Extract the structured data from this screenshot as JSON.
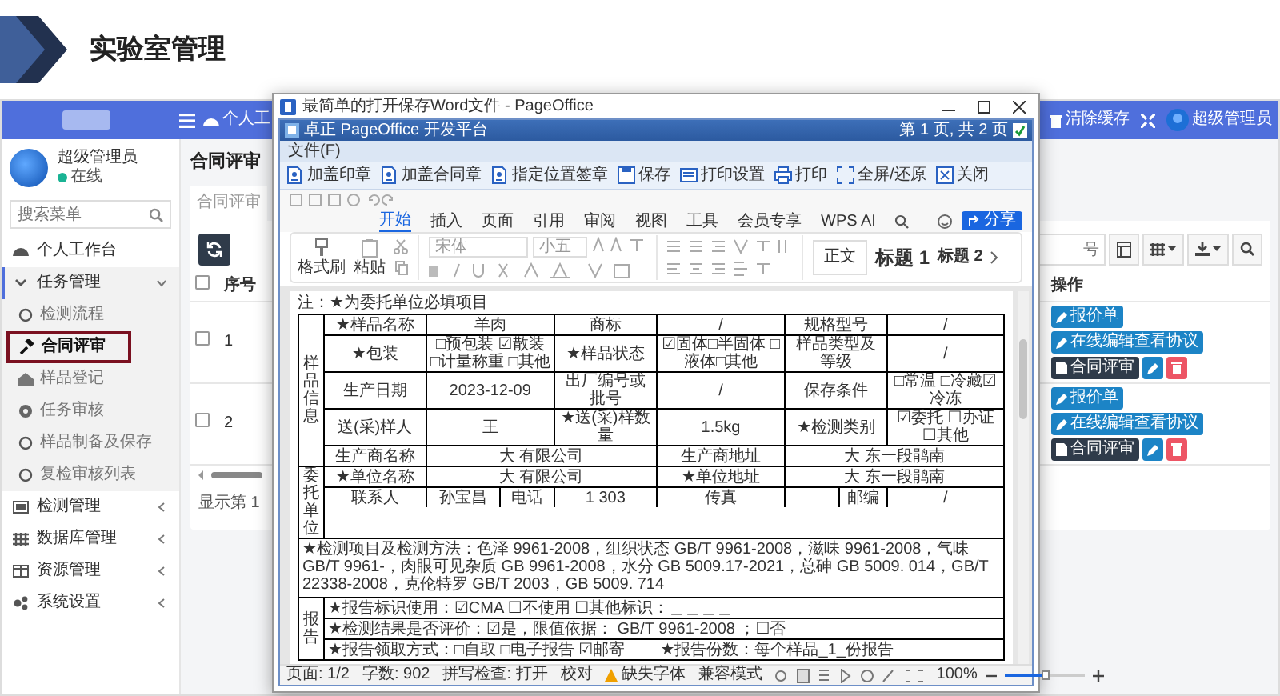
{
  "slide": {
    "title": "实验室管理"
  },
  "navbar": {
    "home_link": "个人工",
    "clear_cache": "清除缓存",
    "user": "超级管理员"
  },
  "sidebar": {
    "user": {
      "name": "超级管理员",
      "status": "在线",
      "online": true
    },
    "search": {
      "placeholder": "搜索菜单"
    },
    "items": [
      {
        "label": "个人工作台",
        "kind": "link"
      },
      {
        "label": "任务管理",
        "kind": "group",
        "expanded": true,
        "children": [
          {
            "label": "检测流程",
            "selected": false
          },
          {
            "label": "合同评审",
            "selected": true
          },
          {
            "label": "样品登记",
            "selected": false
          },
          {
            "label": "任务审核",
            "selected": false
          },
          {
            "label": "样品制备及保存",
            "selected": false
          },
          {
            "label": "复检审核列表",
            "selected": false
          }
        ]
      },
      {
        "label": "检测管理",
        "kind": "group",
        "expanded": false
      },
      {
        "label": "数据库管理",
        "kind": "group",
        "expanded": false
      },
      {
        "label": "资源管理",
        "kind": "group",
        "expanded": false
      },
      {
        "label": "系统设置",
        "kind": "group",
        "expanded": false
      }
    ]
  },
  "content": {
    "title": "合同评审",
    "tabs": [
      {
        "label": "合同评审",
        "selected": true
      }
    ],
    "search": {
      "placeholder": "号"
    },
    "table": {
      "select_all_checked": false,
      "columns": [
        "序号",
        "操作"
      ],
      "rows": [
        {
          "checked": false,
          "number": "1",
          "actions": [
            {
              "kind": "primary",
              "label": "报价单"
            },
            {
              "kind": "primary",
              "label": "在线编辑查看协议"
            },
            {
              "kind": "dark",
              "label": "合同评审"
            },
            {
              "kind": "edit"
            },
            {
              "kind": "delete"
            }
          ]
        },
        {
          "checked": false,
          "number": "2",
          "actions": [
            {
              "kind": "primary",
              "label": "报价单"
            },
            {
              "kind": "primary",
              "label": "在线编辑查看协议"
            },
            {
              "kind": "dark",
              "label": "合同评审"
            },
            {
              "kind": "edit"
            },
            {
              "kind": "delete"
            }
          ]
        }
      ]
    },
    "pager": "显示第 1"
  },
  "window": {
    "title": "最简单的打开保存Word文件 - PageOffice",
    "platform_bar": {
      "title": "卓正 PageOffice 开发平台",
      "page_info": "第 1 页, 共 2 页"
    },
    "menu": [
      "文件(F)"
    ],
    "toolbar": [
      "加盖印章",
      "加盖合同章",
      "指定位置签章",
      "保存",
      "打印设置",
      "打印",
      "全屏/还原",
      "关闭"
    ],
    "ribbon_tabs": [
      {
        "label": "开始",
        "selected": true
      },
      {
        "label": "插入",
        "selected": false
      },
      {
        "label": "页面",
        "selected": false
      },
      {
        "label": "引用",
        "selected": false
      },
      {
        "label": "审阅",
        "selected": false
      },
      {
        "label": "视图",
        "selected": false
      },
      {
        "label": "工具",
        "selected": false
      },
      {
        "label": "会员专享",
        "selected": false
      },
      {
        "label": "WPS AI",
        "selected": false
      }
    ],
    "share_button": "分享",
    "ribbon": {
      "clipboard": [
        "格式刷",
        "粘贴"
      ],
      "font": "宋体",
      "size": "小五",
      "styles": [
        "正文",
        "标题 1",
        "标题 2"
      ]
    },
    "document": {
      "note": "注：★为委托单位必填项目",
      "blocks": [
        {
          "kind": "section",
          "label": "样品信息",
          "rows": [
            [
              "★样品名称",
              {
                "text": "羊肉",
                "colspan": 2
              },
              "商标",
              "/",
              {
                "text": "规格型号",
                "colspan": 2
              },
              "/"
            ],
            [
              "★包装",
              {
                "text": "□预包装 ☑散装 □计量称重 □其他",
                "colspan": 2
              },
              "★样品状态",
              "☑固体□半固体 □液体□其他",
              {
                "text": "样品类型及等级",
                "colspan": 2
              },
              "/"
            ],
            [
              "生产日期",
              {
                "text": "2023-12-09",
                "colspan": 2
              },
              "出厂编号或批号",
              "/",
              {
                "text": "保存条件",
                "colspan": 2
              },
              "□常温 □冷藏☑冷冻"
            ],
            [
              "送(采)样人",
              {
                "text": "王",
                "colspan": 2
              },
              "★送(采)样数量",
              "1.5kg",
              {
                "text": "★检测类别",
                "colspan": 2
              },
              "☑委托 ☐办证 ☐其他"
            ],
            [
              "生产商名称",
              {
                "text": "大 有限公司",
                "colspan": 3
              },
              "生产商地址",
              {
                "text": "大 东一段鹃南",
                "colspan": 3
              }
            ]
          ]
        },
        {
          "kind": "section",
          "label": "委托单位",
          "rows": [
            [
              "★单位名称",
              {
                "text": "大 有限公司",
                "colspan": 3
              },
              "★单位地址",
              {
                "text": "大 东一段鹃南",
                "colspan": 3
              }
            ],
            [
              "联系人",
              "孙宝昌",
              "电话",
              "1 303",
              "传真",
              "",
              "邮编",
              "/"
            ]
          ]
        },
        {
          "kind": "text",
          "text": "★检测项目及检测方法：色泽 9961-2008，组织状态 GB/T 9961-2008，滋味 9961-2008，气味 GB/T 9961-，肉眼可见杂质 GB 9961-2008，水分 GB 5009.17-2021，总砷 GB 5009. 014，GB/T 22338-2008，克伦特罗 GB/T 2003，GB 5009. 714"
        },
        {
          "kind": "section",
          "label": "报告",
          "rows": [
            [
              {
                "text": "★报告标识使用：☑CMA ☐不使用 ☐其他标识：＿＿＿＿",
                "colspan": 8
              }
            ],
            [
              {
                "text": "★检测结果是否评价：☑是，限值依据： GB/T 9961-2008 ；☐否",
                "colspan": 8
              }
            ],
            [
              {
                "text": "★报告领取方式：□自取 □电子报告 ☑邮寄",
                "colspan": 4
              },
              {
                "text": "★报告份数：每个样品_1_份报告",
                "colspan": 4
              }
            ]
          ]
        }
      ]
    },
    "status_bar": {
      "items": [
        "页面: 1/2",
        "字数: 902",
        "拼写检查: 打开",
        "校对",
        "缺失字体",
        "兼容模式"
      ],
      "zoom": "100%",
      "zoom_slider": {
        "level": 0.5
      }
    }
  }
}
